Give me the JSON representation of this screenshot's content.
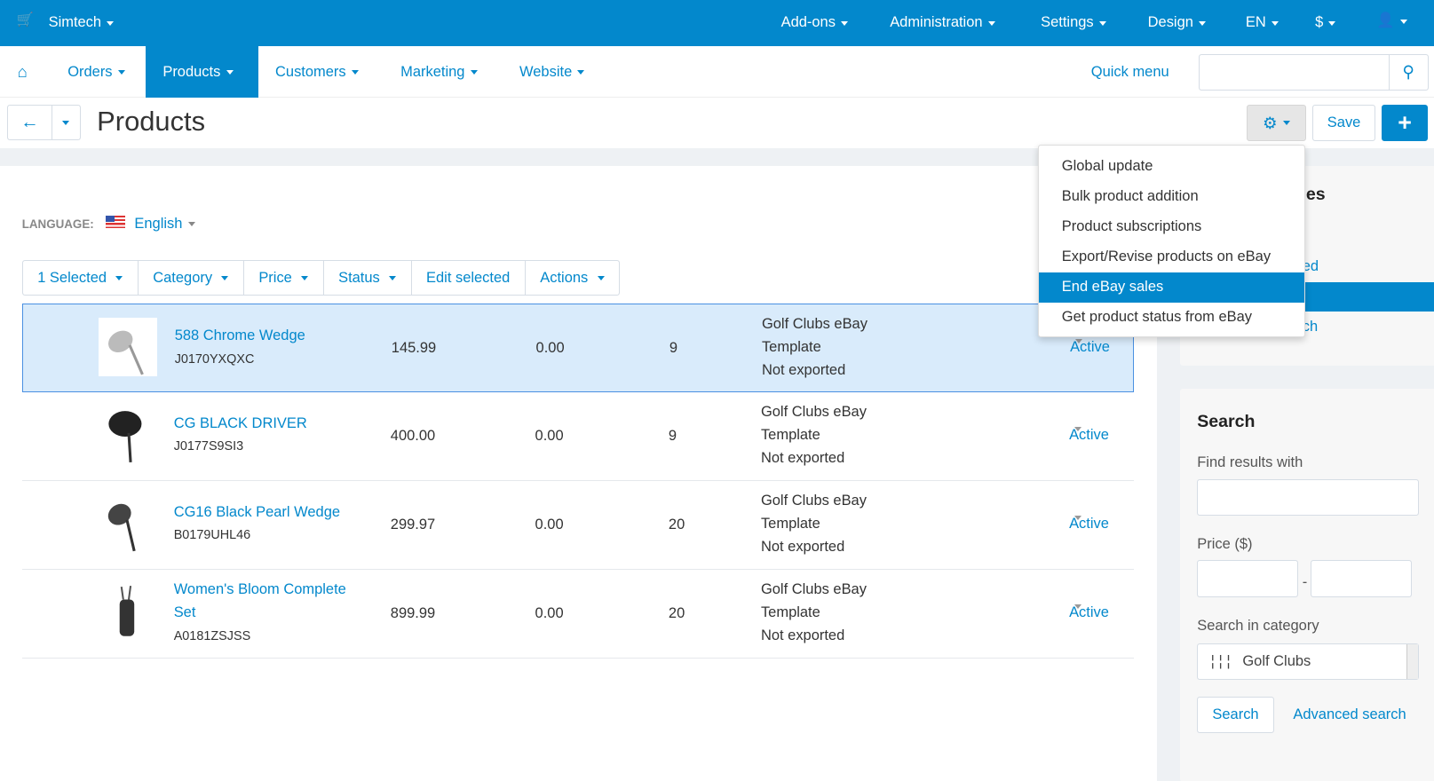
{
  "topbar": {
    "store": "Simtech",
    "menus": [
      "Add-ons",
      "Administration",
      "Settings",
      "Design",
      "EN",
      "$"
    ],
    "icons": [
      "cart-icon",
      "user-icon"
    ]
  },
  "nav": {
    "items": [
      "Orders",
      "Products",
      "Customers",
      "Marketing",
      "Website"
    ],
    "active": "Products",
    "quick_menu": "Quick menu",
    "search_placeholder": ""
  },
  "toolbar": {
    "title": "Products",
    "save": "Save"
  },
  "language": {
    "label": "LANGUAGE:",
    "value": "English"
  },
  "filters": [
    "1 Selected",
    "Category",
    "Price",
    "Status",
    "Edit selected",
    "Actions"
  ],
  "products": [
    {
      "name": "588 Chrome Wedge",
      "code": "J0170YXQXC",
      "price": "145.99",
      "list_price": "0.00",
      "qty": "9",
      "ebay": [
        "Golf Clubs eBay",
        "Template",
        "Not exported"
      ],
      "status": "Active",
      "selected": true
    },
    {
      "name": "CG BLACK DRIVER",
      "code": "J0177S9SI3",
      "price": "400.00",
      "list_price": "0.00",
      "qty": "9",
      "ebay": [
        "Golf Clubs eBay",
        "Template",
        "Not exported"
      ],
      "status": "Active"
    },
    {
      "name": "CG16 Black Pearl Wedge",
      "code": "B0179UHL46",
      "price": "299.97",
      "list_price": "0.00",
      "qty": "20",
      "ebay": [
        "Golf Clubs eBay",
        "Template",
        "Not exported"
      ],
      "status": "Active"
    },
    {
      "name_line1": "Women's Bloom Complete",
      "name_line2": "Set",
      "code": "A0181ZSJSS",
      "price": "899.99",
      "list_price": "0.00",
      "qty": "20",
      "ebay": [
        "Golf Clubs eBay",
        "Template",
        "Not exported"
      ],
      "status": "Active"
    }
  ],
  "gear_menu": {
    "items": [
      "Global update",
      "Bulk product addition",
      "Product subscriptions",
      "Export/Revise products on eBay",
      "End eBay sales",
      "Get product status from eBay"
    ],
    "highlighted": "End eBay sales"
  },
  "saved_panel": {
    "title_fragment": "es",
    "item_fragments": [
      "ed",
      "ch"
    ]
  },
  "search": {
    "title": "Search",
    "find_label": "Find results with",
    "price_label": "Price ($)",
    "price_sep": "-",
    "category_label": "Search in category",
    "category_value": "¦ ¦ ¦   Golf Clubs",
    "search_button": "Search",
    "advanced": "Advanced search"
  },
  "colors": {
    "primary": "#0388cc",
    "selected_row": "#d9ebfb"
  }
}
